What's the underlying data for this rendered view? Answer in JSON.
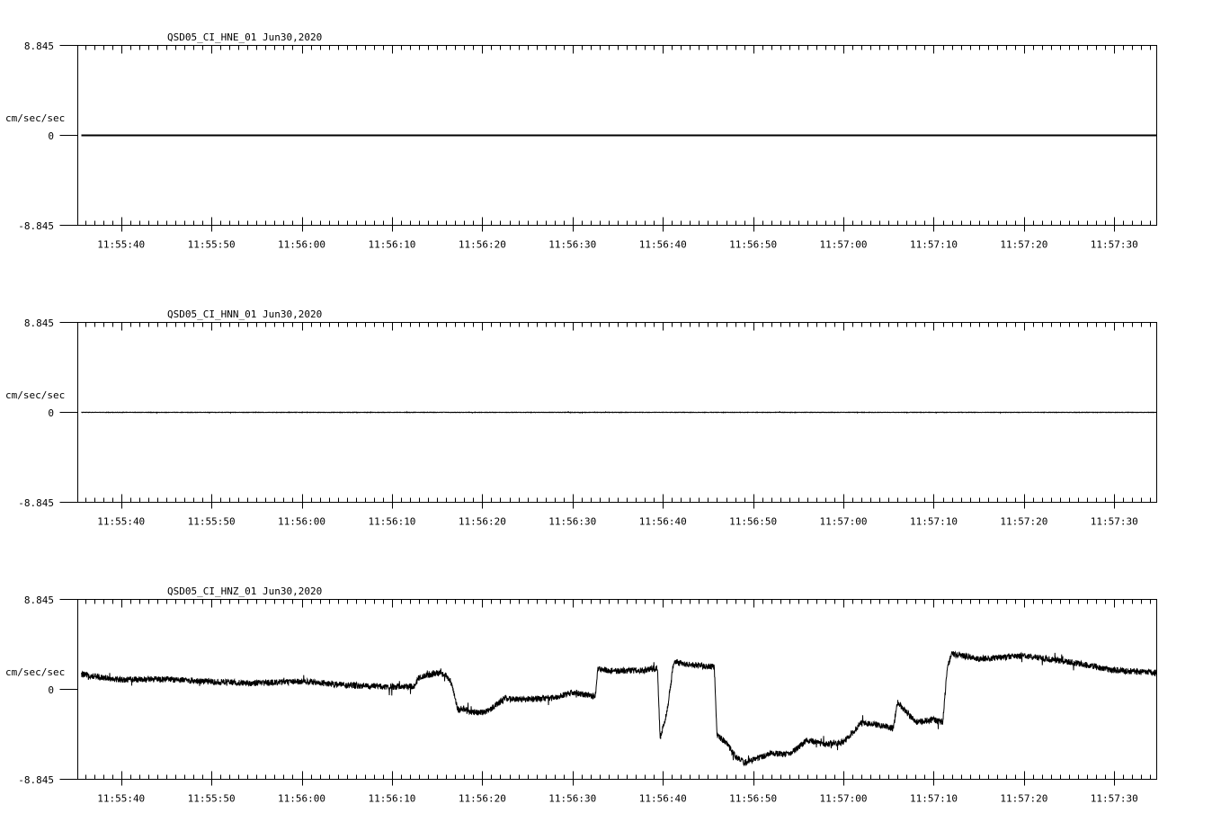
{
  "chart_data": [
    {
      "type": "line",
      "title": "QSD05_CI_HNE_01  Jun30,2020",
      "ylabel": "cm/sec/sec",
      "ylim": [
        -8.845,
        8.845
      ],
      "y_tick_labels": [
        "8.845",
        "0",
        "-8.845"
      ],
      "x_tick_labels": [
        "11:55:40",
        "11:55:50",
        "11:56:00",
        "11:56:10",
        "11:56:20",
        "11:56:30",
        "11:56:40",
        "11:56:50",
        "11:57:00",
        "11:57:10",
        "11:57:20",
        "11:57:30"
      ],
      "x_range": [
        "11:55:35.2",
        "11:57:34.7"
      ],
      "series": [
        {
          "x": [
            "11:55:35.6",
            "11:57:34.7"
          ],
          "values": [
            0,
            0
          ]
        }
      ]
    },
    {
      "type": "line",
      "title": "QSD05_CI_HNN_01  Jun30,2020",
      "ylabel": "cm/sec/sec",
      "ylim": [
        -8.845,
        8.845
      ],
      "y_tick_labels": [
        "8.845",
        "0",
        "-8.845"
      ],
      "x_tick_labels": [
        "11:55:40",
        "11:55:50",
        "11:56:00",
        "11:56:10",
        "11:56:20",
        "11:56:30",
        "11:56:40",
        "11:56:50",
        "11:57:00",
        "11:57:10",
        "11:57:20",
        "11:57:30"
      ],
      "x_range": [
        "11:55:35.2",
        "11:57:34.7"
      ],
      "series": [
        {
          "x": [
            "11:55:35.6",
            "11:57:34.7"
          ],
          "values": [
            0,
            0
          ],
          "noise_amplitude": 0.02
        }
      ]
    },
    {
      "type": "line",
      "title": "QSD05_CI_HNZ_01  Jun30,2020",
      "ylabel": "cm/sec/sec",
      "ylim": [
        -8.845,
        8.845
      ],
      "y_tick_labels": [
        "8.845",
        "0",
        "-8.845"
      ],
      "x_tick_labels": [
        "11:55:40",
        "11:55:50",
        "11:56:00",
        "11:56:10",
        "11:56:20",
        "11:56:30",
        "11:56:40",
        "11:56:50",
        "11:57:00",
        "11:57:10",
        "11:57:20",
        "11:57:30"
      ],
      "x_range": [
        "11:55:35.2",
        "11:57:34.7"
      ],
      "series": [
        {
          "x": [
            "11:55:35.6",
            "11:55:40.0",
            "11:55:45.0",
            "11:55:50.0",
            "11:55:55.0",
            "11:56:00.0",
            "11:56:05.0",
            "11:56:10.0",
            "11:56:12.5",
            "11:56:13.0",
            "11:56:15.0",
            "11:56:16.0",
            "11:56:16.5",
            "11:56:17.3",
            "11:56:18.0",
            "11:56:19.0",
            "11:56:20.5",
            "11:56:22.5",
            "11:56:25.0",
            "11:56:28.0",
            "11:56:30.0",
            "11:56:32.5",
            "11:56:32.8",
            "11:56:35.0",
            "11:56:38.0",
            "11:56:39.4",
            "11:56:39.7",
            "11:56:40.3",
            "11:56:40.6",
            "11:56:41.2",
            "11:56:43.0",
            "11:56:45.7",
            "11:56:46.0",
            "11:56:47.0",
            "11:56:48.0",
            "11:56:49.0",
            "11:56:50.0",
            "11:56:52.0",
            "11:56:54.0",
            "11:56:56.0",
            "11:56:58.0",
            "11:57:00.0",
            "11:57:02.0",
            "11:57:04.0",
            "11:57:05.5",
            "11:57:06.0",
            "11:57:08.0",
            "11:57:10.0",
            "11:57:11.0",
            "11:57:11.5",
            "11:57:12.0",
            "11:57:15.0",
            "11:57:20.0",
            "11:57:25.0",
            "11:57:30.0",
            "11:57:34.7"
          ],
          "values": [
            1.45,
            0.95,
            1.0,
            0.75,
            0.6,
            0.8,
            0.4,
            0.25,
            0.3,
            1.2,
            1.6,
            1.4,
            0.8,
            -2.0,
            -1.9,
            -2.3,
            -2.2,
            -0.9,
            -1.0,
            -0.8,
            -0.3,
            -0.7,
            2.0,
            1.8,
            1.9,
            2.1,
            -4.8,
            -2.8,
            -1.4,
            2.7,
            2.4,
            2.2,
            -4.5,
            -5.2,
            -6.6,
            -7.2,
            -6.9,
            -6.3,
            -6.4,
            -5.0,
            -5.4,
            -5.2,
            -3.3,
            -3.5,
            -3.8,
            -1.3,
            -3.2,
            -3.0,
            -3.3,
            2.1,
            3.5,
            3.0,
            3.3,
            2.7,
            1.9,
            1.6
          ],
          "noise_amplitude": 0.3
        }
      ]
    }
  ]
}
